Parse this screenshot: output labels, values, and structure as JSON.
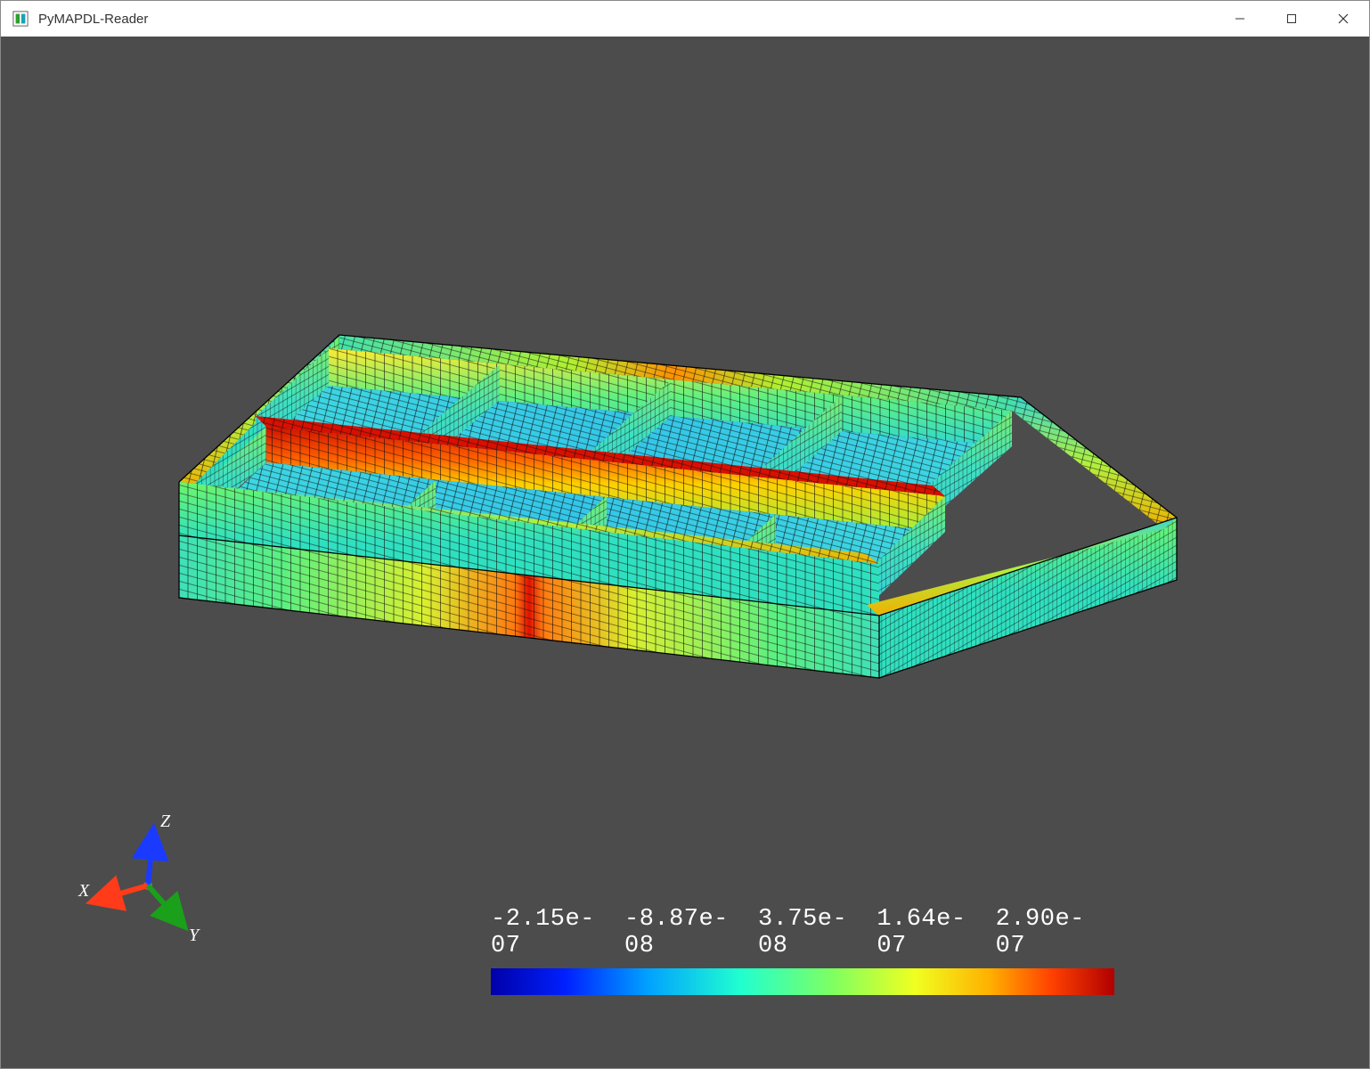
{
  "window": {
    "title": "PyMAPDL-Reader"
  },
  "axes": {
    "x_label": "X",
    "y_label": "Y",
    "z_label": "Z"
  },
  "scalar_bar": {
    "ticks": [
      "-2.15e-07",
      "-8.87e-08",
      "3.75e-08",
      "1.64e-07",
      "2.90e-07"
    ]
  },
  "chart_data": {
    "type": "heatmap",
    "title": "",
    "colormap": "jet",
    "scalar_range": [
      -2.15e-07,
      2.9e-07
    ],
    "tick_values": [
      -2.15e-07,
      -8.87e-08,
      3.75e-08,
      1.64e-07,
      2.9e-07
    ],
    "axes": [
      "X",
      "Y",
      "Z"
    ],
    "description": "3D FEA mesh of a rectangular stiffened panel with 8 recessed bays (2 rows × 4 columns) colored by a scalar result. Central longitudinal rib and outer side walls peak red (~2.9e-07); interior bay floors are cyan/blue (~ -2e-07 to -9e-08); outer hull and transverse walls grade green→yellow."
  }
}
